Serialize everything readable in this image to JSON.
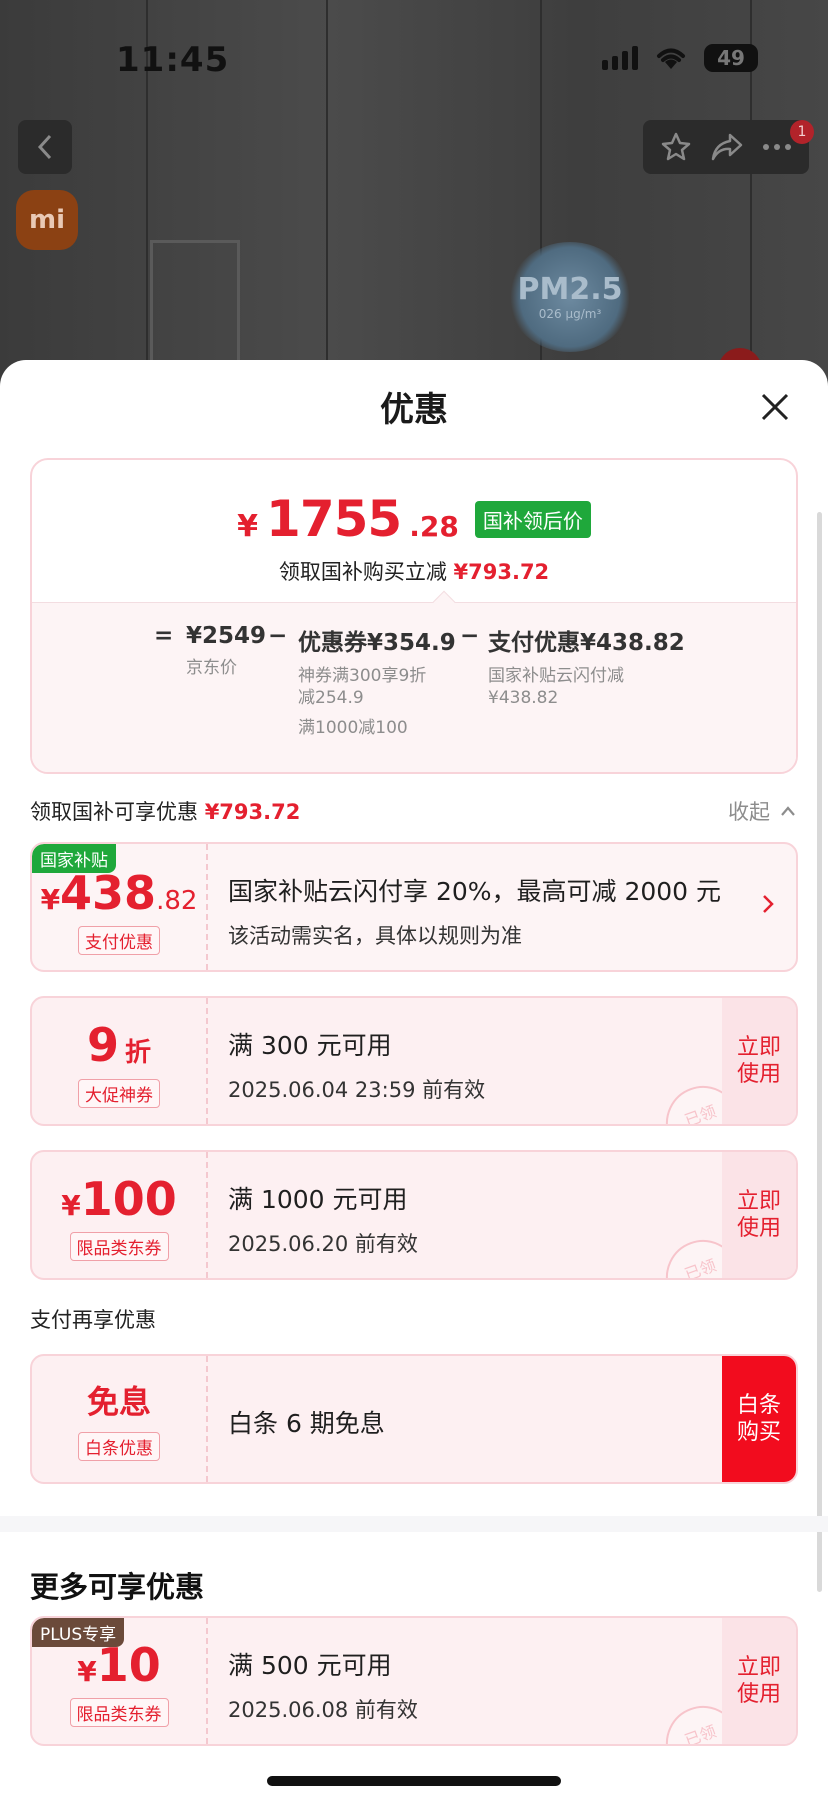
{
  "status_bar": {
    "time": "11:45",
    "battery": "49"
  },
  "background": {
    "brand_logo": "mi",
    "pm_badge": {
      "title": "PM2.5",
      "value": "026 μg/m³"
    },
    "notification_count": "1"
  },
  "sheet": {
    "title": "优惠",
    "summary": {
      "final_price": {
        "currency": "¥",
        "integer": "1755",
        "decimal": ".28"
      },
      "final_tag": "国补领后价",
      "claim_text": "领取国补购买立减",
      "claim_amount": "¥793.72",
      "formula": {
        "equals": "=",
        "jd_price": "¥2549",
        "jd_price_label": "京东价",
        "minus1": "−",
        "coupon": "优惠券¥354.9",
        "coupon_note1": "神券满300享9折",
        "coupon_note2": "减254.9",
        "coupon_note3": "满1000减100",
        "minus2": "−",
        "payment": "支付优惠¥438.82",
        "payment_note1": "国家补贴云闪付减",
        "payment_note2": "¥438.82"
      }
    },
    "subsidy_section": {
      "label": "领取国补可享优惠",
      "amount": "¥793.72",
      "collapse": "收起"
    },
    "coupons": [
      {
        "corner_tag": "国家补贴",
        "yen": "¥",
        "value": "438",
        "decimal": ".82",
        "label": "支付优惠",
        "line1": "国家补贴云闪付享 20%，最高可减 2000 元",
        "line2": "该活动需实名，具体以规则为准"
      },
      {
        "value": "9",
        "unit": "折",
        "label": "大促神券",
        "line1": "满 300 元可用",
        "line2": "2025.06.04 23:59 前有效",
        "action": "立即使用",
        "stamp": "已领"
      },
      {
        "yen": "¥",
        "value": "100",
        "label": "限品类东券",
        "line1": "满 1000 元可用",
        "line2": "2025.06.20 前有效",
        "action": "立即使用",
        "stamp": "已领"
      }
    ],
    "payment_section": {
      "label": "支付再享优惠"
    },
    "baitiao": {
      "value": "免息",
      "label": "白条优惠",
      "text": "白条 6 期免息",
      "action": "白条购买"
    },
    "more_section": {
      "title": "更多可享优惠",
      "coupon": {
        "corner_tag": "PLUS专享",
        "yen": "¥",
        "value": "10",
        "label": "限品类东券",
        "line1": "满 500 元可用",
        "line2": "2025.06.08 前有效",
        "action": "立即使用",
        "stamp": "已领"
      }
    }
  },
  "colors": {
    "accent_red": "#e4202f",
    "subsidy_green": "#1fa83b",
    "plus_brown": "#6b4a3a",
    "card_pink": "#fdf0f2"
  }
}
